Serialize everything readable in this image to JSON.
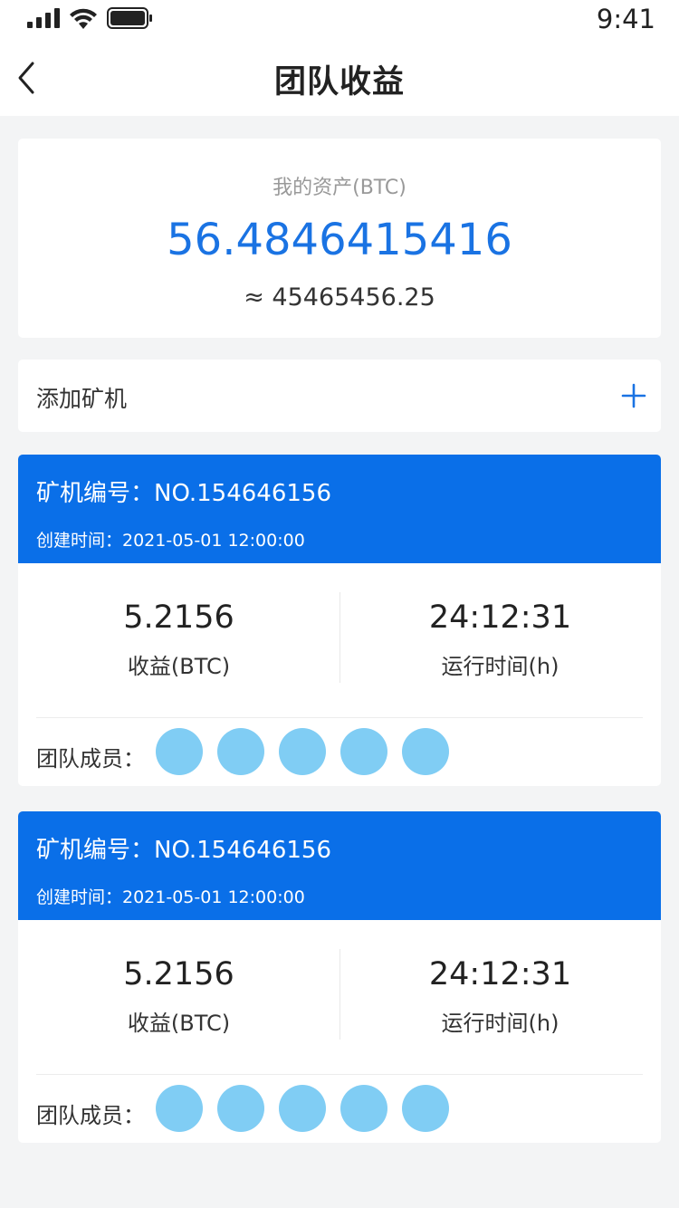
{
  "status_bar": {
    "time": "9:41"
  },
  "nav": {
    "title": "团队收益"
  },
  "asset": {
    "label": "我的资产(BTC)",
    "value": "56.4846415416",
    "approx": "≈ 45465456.25"
  },
  "add_miner": {
    "label": "添加矿机"
  },
  "miners": [
    {
      "number": "矿机编号：NO.154646156",
      "created": "创建时间：2021-05-01 12:00:00",
      "earnings_value": "5.2156",
      "earnings_label": "收益(BTC)",
      "runtime_value": "24:12:31",
      "runtime_label": "运行时间(h)",
      "members_label": "团队成员："
    },
    {
      "number": "矿机编号：NO.154646156",
      "created": "创建时间：2021-05-01 12:00:00",
      "earnings_value": "5.2156",
      "earnings_label": "收益(BTC)",
      "runtime_value": "24:12:31",
      "runtime_label": "运行时间(h)",
      "members_label": "团队成员："
    }
  ],
  "colors": {
    "accent": "#0a6fe8",
    "asset_value": "#1a73e3",
    "avatar": "#80cdf4"
  }
}
